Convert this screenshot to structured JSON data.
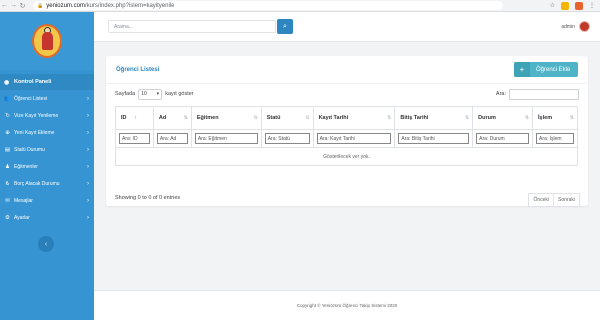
{
  "browser": {
    "url_host": "yeniozum.com",
    "url_path": "/kurs/index.php?islem=kayityenile"
  },
  "sidebar": {
    "panel_title": "Kontrol Paneli",
    "items": [
      {
        "label": "Öğrenci Listesi",
        "icon": "users-icon"
      },
      {
        "label": "Vize Kayıt Yenileme",
        "icon": "refresh-icon"
      },
      {
        "label": "Yeni Kayıt Ekleme",
        "icon": "plus-icon"
      },
      {
        "label": "Statü Durumu",
        "icon": "chart-icon"
      },
      {
        "label": "Eğitmenler",
        "icon": "teacher-icon"
      },
      {
        "label": "Borç Alacak Durumu",
        "icon": "money-icon"
      },
      {
        "label": "Mesajlar",
        "icon": "envelope-icon"
      },
      {
        "label": "Ayarlar",
        "icon": "gear-icon"
      }
    ]
  },
  "topbar": {
    "search_placeholder": "Arama...",
    "user_name": "admin"
  },
  "card": {
    "title": "Öğrenci Listesi",
    "add_label": "Öğrenci Ekle"
  },
  "table_ctrl": {
    "before_len": "Sayfada",
    "len_value": "10",
    "after_len": "kayıt göster",
    "search_label": "Ara:"
  },
  "table": {
    "columns": [
      "ID",
      "Ad",
      "Eğitmen",
      "Statü",
      "Kayıt Tarihi",
      "Bitiş Tarihi",
      "Durum",
      "İşlem"
    ],
    "filters": [
      "Ara: ID",
      "Ara: Ad",
      "Ara: Eğitmen",
      "Ara: Statü",
      "Ara: Kayıt Tarihi",
      "Ara: Bitiş Tarihi",
      "Ara: Durum",
      "Ara: İşlem"
    ],
    "empty_text": "Gösterilecek ver yok."
  },
  "footer_info": {
    "entries_text": "Showing 0 to 0 of 0 entries",
    "prev_label": "Önceki",
    "next_label": "Sonraki"
  },
  "footer": {
    "copyright": "Copyright © Yeniözüm Öğrenci Takip Sistemi 2020"
  },
  "colors": {
    "sidebar": "#3594d1",
    "accent": "#2e86c1",
    "add_button": "#4fb4c7"
  }
}
